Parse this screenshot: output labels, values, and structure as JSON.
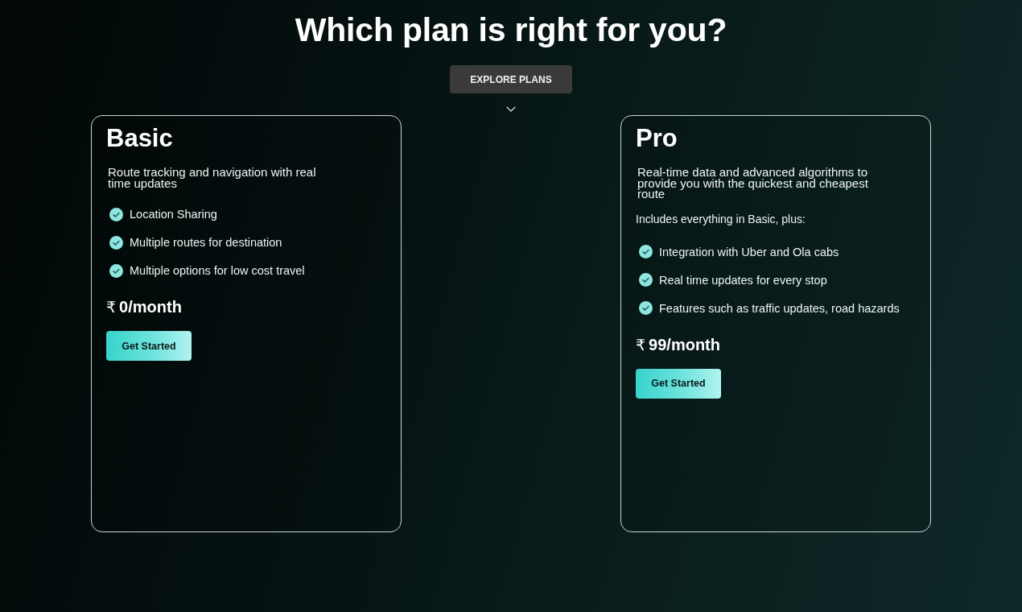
{
  "heading": "Which plan is right for you?",
  "explore_button": "EXPLORE PLANS",
  "plans": [
    {
      "name": "Basic",
      "description": "Route tracking and navigation with real time updates",
      "features": [
        "Location Sharing",
        "Multiple routes for destination",
        "Multiple options for low cost travel"
      ],
      "currency": "₹",
      "price": "0/month",
      "button": "Get Started"
    },
    {
      "name": "Pro",
      "description": "Real-time data and advanced algorithms to provide you with the quickest and cheapest route",
      "includes": "Includes everything in Basic, plus:",
      "features": [
        "Integration with Uber and Ola cabs",
        "Real time updates for every stop",
        "Features such as traffic updates, road hazards"
      ],
      "currency": "₹",
      "price": "99/month",
      "button": "Get Started"
    }
  ]
}
